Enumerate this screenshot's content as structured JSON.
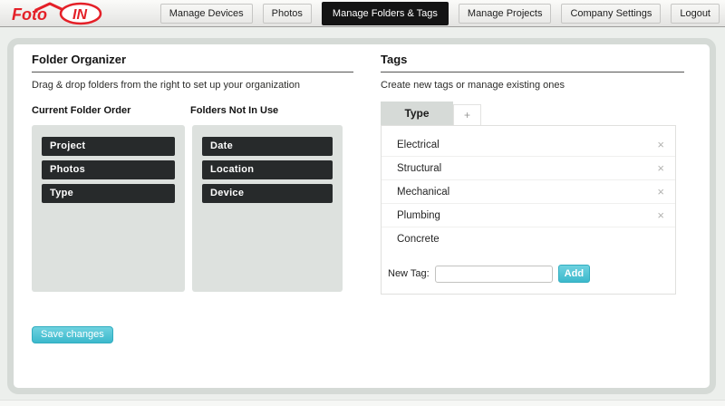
{
  "logo": {
    "part1": "Foto",
    "part2": "IN"
  },
  "nav": {
    "items": [
      {
        "label": "Manage Devices",
        "active": false
      },
      {
        "label": "Photos",
        "active": false
      },
      {
        "label": "Manage Folders & Tags",
        "active": true
      },
      {
        "label": "Manage Projects",
        "active": false
      },
      {
        "label": "Company Settings",
        "active": false
      },
      {
        "label": "Logout",
        "active": false
      }
    ]
  },
  "folder_organizer": {
    "title": "Folder Organizer",
    "subtitle": "Drag & drop folders from the right to set up your organization",
    "columns": [
      {
        "header": "Current Folder Order",
        "folders": [
          "Project",
          "Photos",
          "Type"
        ]
      },
      {
        "header": "Folders Not In Use",
        "folders": [
          "Date",
          "Location",
          "Device"
        ]
      }
    ],
    "save_button_label": "Save changes"
  },
  "tags": {
    "title": "Tags",
    "subtitle": "Create new tags or manage existing ones",
    "active_tab_label": "Type",
    "add_tab_label": "+",
    "items": [
      {
        "label": "Electrical",
        "removable": true
      },
      {
        "label": "Structural",
        "removable": true
      },
      {
        "label": "Mechanical",
        "removable": true
      },
      {
        "label": "Plumbing",
        "removable": true
      },
      {
        "label": "Concrete",
        "removable": false
      }
    ],
    "close_icon": "×",
    "new_tag_label": "New Tag:",
    "new_tag_input_value": "",
    "add_button_label": "Add"
  },
  "colors": {
    "accent_teal": "#45c3d5",
    "logo_red": "#e42028",
    "active_nav_bg": "#141414",
    "folder_bar_bg": "#272a2b",
    "panel_gray": "#dde1de"
  }
}
